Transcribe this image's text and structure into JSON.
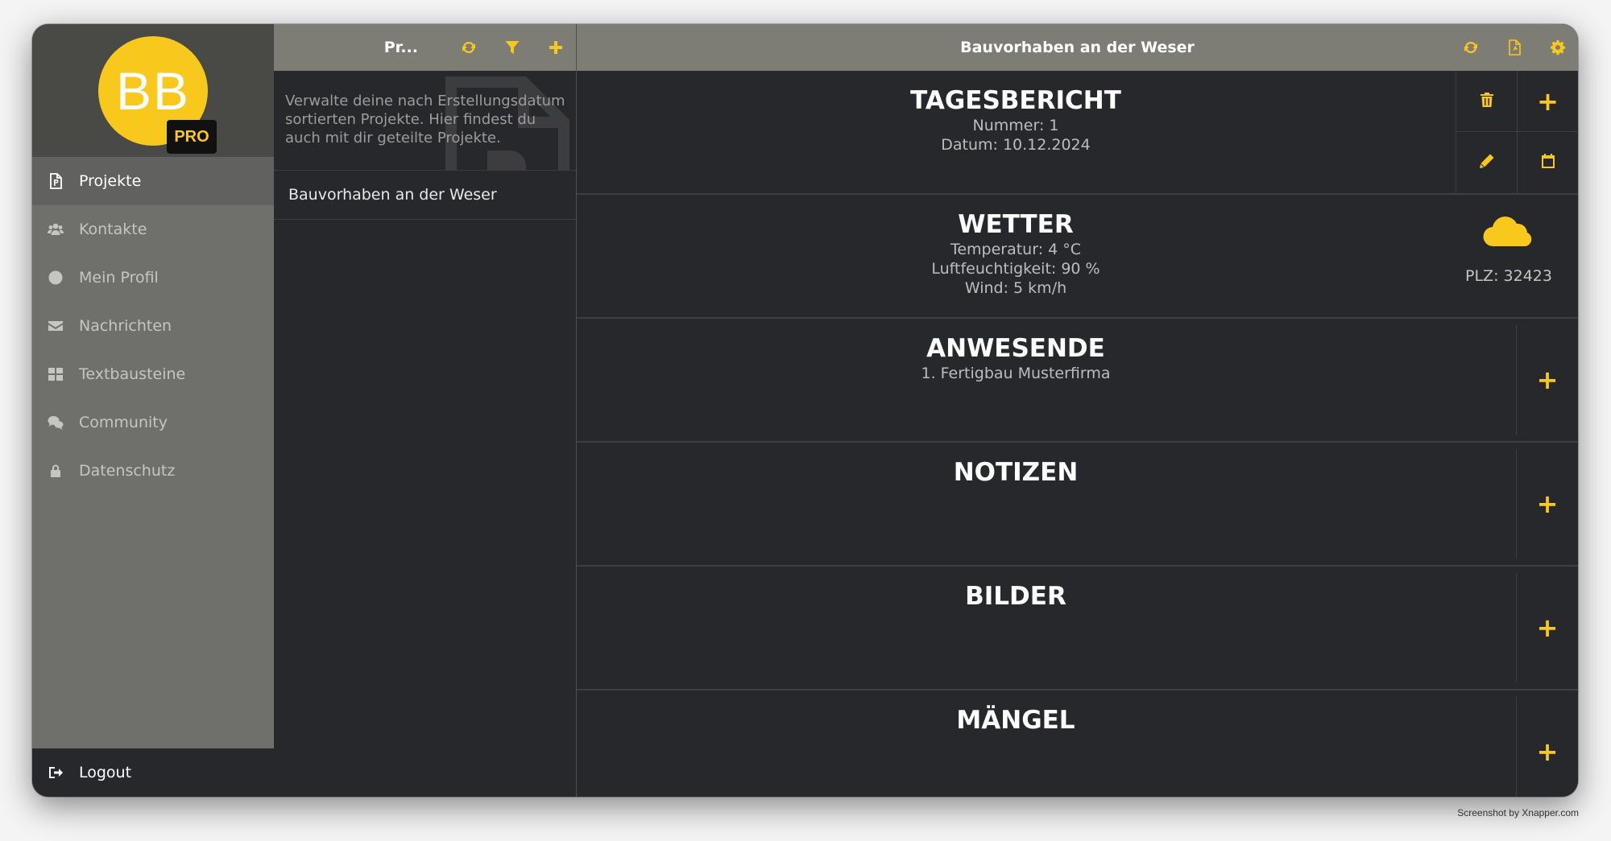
{
  "profile": {
    "initials": "BB",
    "badge": "PRO"
  },
  "sidebar": {
    "items": [
      {
        "label": "Projekte",
        "icon": "document-icon",
        "active": true
      },
      {
        "label": "Kontakte",
        "icon": "users-icon"
      },
      {
        "label": "Mein Profil",
        "icon": "user-circle-icon"
      },
      {
        "label": "Nachrichten",
        "icon": "envelope-icon"
      },
      {
        "label": "Textbausteine",
        "icon": "grid-icon"
      },
      {
        "label": "Community",
        "icon": "chat-bubbles-icon"
      },
      {
        "label": "Datenschutz",
        "icon": "lock-icon"
      }
    ],
    "logout_label": "Logout"
  },
  "projects": {
    "title": "Pr...",
    "intro": "Verwalte deine nach Erstellungsdatum sortierten Projekte. Hier findest du auch mit dir geteilte Projekte.",
    "items": [
      "Bauvorhaben an der Weser"
    ]
  },
  "main": {
    "title": "Bauvorhaben an der Weser",
    "report": {
      "title": "TAGESBERICHT",
      "number": "Nummer: 1",
      "date": "Datum: 10.12.2024"
    },
    "weather": {
      "title": "WETTER",
      "temperature": "Temperatur: 4 °C",
      "humidity": "Luftfeuchtigkeit: 90 %",
      "wind": "Wind: 5 km/h",
      "plz": "PLZ: 32423",
      "icon": "cloud-icon"
    },
    "attendees": {
      "title": "ANWESENDE",
      "items": [
        "1. Fertigbau Musterfirma"
      ]
    },
    "notes": {
      "title": "NOTIZEN"
    },
    "images": {
      "title": "BILDER"
    },
    "defects": {
      "title": "MÄNGEL"
    },
    "plus_symbol": "+"
  },
  "credit": "Screenshot by Xnapper.com",
  "colors": {
    "accent": "#f8c81c",
    "background": "#27282b",
    "header": "#7d7d76",
    "sidebar": "#6f6f6b"
  }
}
